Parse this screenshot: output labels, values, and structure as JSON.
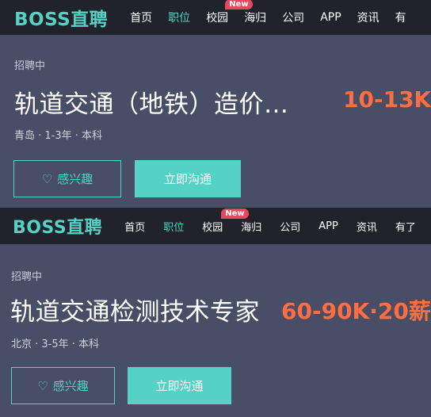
{
  "screens": [
    {
      "logo": "BOSS直聘",
      "nav": [
        "首页",
        "职位",
        "校园",
        "海归",
        "公司",
        "APP",
        "资讯",
        "有"
      ],
      "badge": "New",
      "status": "招聘中",
      "title": "轨道交通（地铁）造价…",
      "salary": "10-13K",
      "meta": "青岛 · 1-3年 · 本科",
      "interest_label": "感兴趣",
      "chat_label": "立即沟通"
    },
    {
      "logo": "BOSS直聘",
      "nav": [
        "首页",
        "职位",
        "校园",
        "海归",
        "公司",
        "APP",
        "资讯",
        "有了"
      ],
      "badge": "New",
      "status": "招聘中",
      "title": "轨道交通检测技术专家",
      "salary": "60-90K·20薪",
      "meta": "北京 · 3-5年 · 本科",
      "interest_label": "感兴趣",
      "chat_label": "立即沟通"
    }
  ],
  "colors": {
    "accent": "#55d1c5",
    "salary": "#ff6e42",
    "nav_bg": "#202329",
    "badge": "#e8485d"
  },
  "icons": {
    "interest": "heart-outline-icon"
  }
}
